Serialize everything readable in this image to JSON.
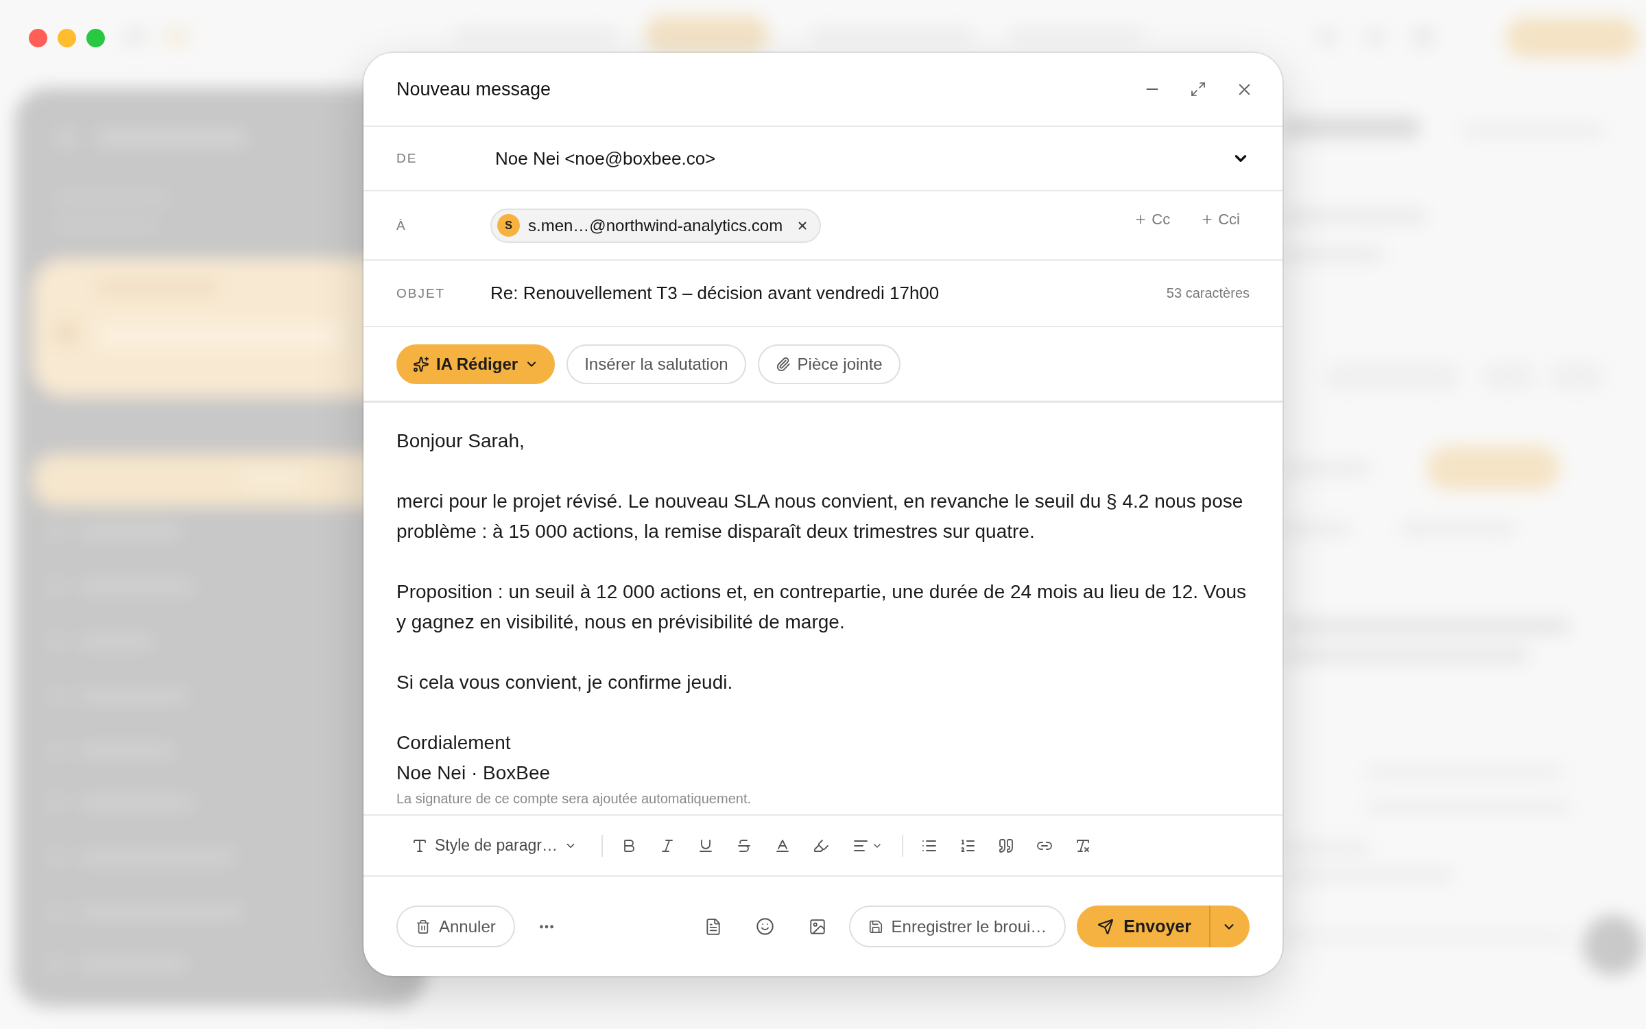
{
  "compose": {
    "title": "Nouveau message",
    "from": {
      "label": "DE",
      "value": "Noe Nei <noe@boxbee.co>"
    },
    "to": {
      "label": "À",
      "recipients": [
        {
          "initial": "S",
          "address": "s.men…@northwind-analytics.com"
        }
      ],
      "extra_fields": [
        "Cc",
        "Cci"
      ]
    },
    "subject": {
      "label": "OBJET",
      "value": "Re: Renouvellement T3 – décision avant vendredi 17h00",
      "counter": "53 caractères"
    },
    "actions": [
      {
        "kind": "ai",
        "label": "IA Rédiger"
      },
      {
        "kind": "text",
        "label": "Insérer la salutation"
      },
      {
        "kind": "attachment",
        "label": "Pièce jointe"
      }
    ],
    "body": {
      "paragraphs": [
        {
          "lines": [
            "Bonjour Sarah,"
          ]
        },
        {
          "lines": [
            "merci pour le projet révisé. Le nouveau SLA nous convient, en revanche le seuil du § 4.2 nous pose problème : à 15 000 actions, la remise disparaît deux trimestres sur quatre."
          ]
        },
        {
          "lines": [
            "Proposition : un seuil à 12 000 actions et, en contrepartie, une durée de 24 mois au lieu de 12. Vous y gagnez en visibilité, nous en prévisibilité de marge."
          ]
        },
        {
          "lines": [
            "Si cela vous convient, je confirme jeudi."
          ]
        },
        {
          "lines": [
            "Cordialement",
            "Noe Nei · BoxBee"
          ]
        }
      ],
      "note": "La signature de ce compte sera ajoutée automatiquement."
    },
    "format_bar": {
      "paragraph_style": "Style de paragr…"
    },
    "footer": {
      "cancel": "Annuler",
      "save_draft": "Enregistrer le broui…",
      "send": "Envoyer"
    }
  }
}
